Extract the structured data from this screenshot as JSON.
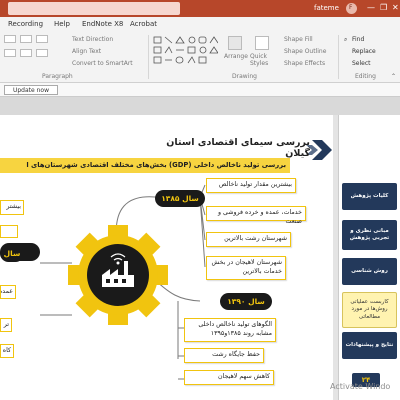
{
  "titlebar": {
    "user": "fateme",
    "avatar_initial": "F",
    "minimize": "—",
    "restore": "❐",
    "close": "✕"
  },
  "menubar": {
    "items": [
      "Recording",
      "Help",
      "EndNote X8",
      "Acrobat"
    ]
  },
  "ribbon": {
    "paragraph": {
      "text_direction": "Text Direction",
      "align_text": "Align Text",
      "smartart": "Convert to SmartArt",
      "group_label": "Paragraph"
    },
    "drawing": {
      "arrange": "Arrange",
      "quick_styles": "Quick Styles",
      "shape_fill": "Shape Fill",
      "shape_outline": "Shape Outline",
      "shape_effects": "Shape Effects",
      "group_label": "Drawing"
    },
    "editing": {
      "find": "Find",
      "replace": "Replace",
      "select": "Select",
      "group_label": "Editing"
    }
  },
  "update_button": "Update now",
  "slide": {
    "title": "بررسی سیمای اقتصادی  استان گیلان",
    "subtitle": "بررسی تولید ناخالص داخلی (GDP) بخش‌های مختلف اقتصادی شهرستان‌های ا",
    "year1": "سال ۱۳۸۵",
    "year2": "سال ۱۳۹۰",
    "boxes1": [
      "بیشترین مقدار تولید ناخالص",
      "خدمات، عمده و خرده فروشی و صنعت",
      "شهرستان رشت بالاترین",
      "شهرستان لاهیجان در بخش خدمات بالاترین"
    ],
    "boxes2": [
      "الگوهای تولید ناخالص داخلی مشابه روند ۱۳۸۵و۱۳۹۵",
      "حفظ جایگاه رشت",
      "کاهش سهم لاهیجان"
    ],
    "left_fragments": [
      "بیشتر",
      "سال",
      "عمده",
      "تر",
      "کاه"
    ]
  },
  "rightnav": {
    "items": [
      "کلیات پژوهش",
      "مبانی نظری و تجربی پژوهش",
      "روش شناسی",
      "کاربست عملیاتی روش‌ها در مورد مطالعاتی",
      "نتایج و پیشنهادات"
    ],
    "page": "۲۴"
  },
  "watermark": "Activate Windo",
  "colors": {
    "accent": "#b7472a",
    "yellow": "#f1c40f",
    "navy": "#23395b"
  }
}
